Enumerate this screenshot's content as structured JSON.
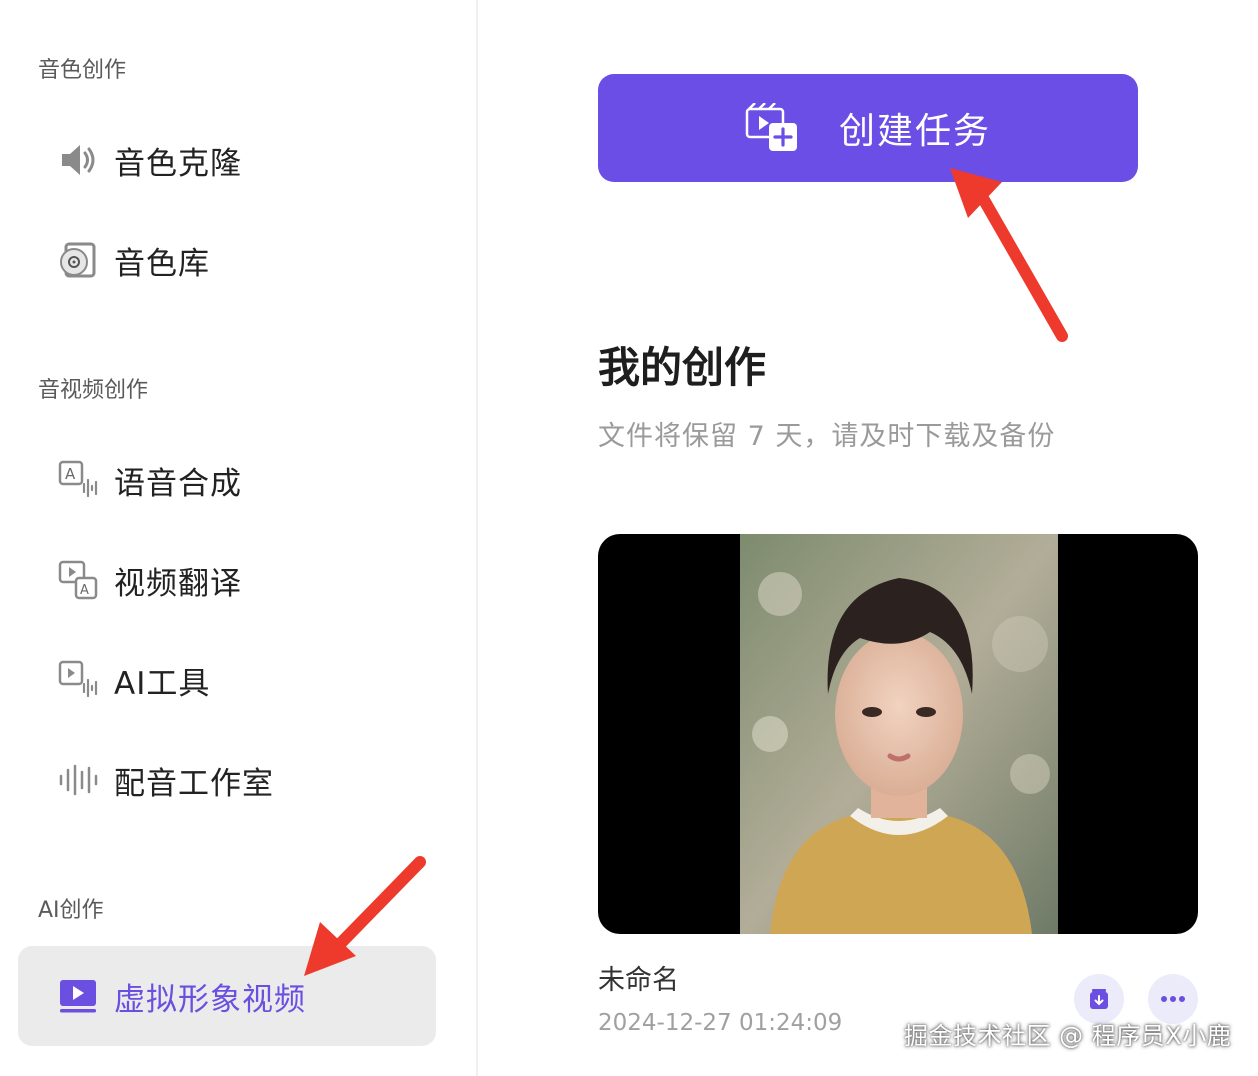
{
  "sidebar": {
    "sections": [
      {
        "title": "音色创作"
      },
      {
        "title": "音视频创作"
      },
      {
        "title": "AI创作"
      }
    ],
    "items": [
      {
        "label": "音色克隆",
        "icon": "speaker-icon"
      },
      {
        "label": "音色库",
        "icon": "disc-icon"
      },
      {
        "label": "语音合成",
        "icon": "text-to-speech-icon"
      },
      {
        "label": "视频翻译",
        "icon": "video-translate-icon"
      },
      {
        "label": "AI工具",
        "icon": "ai-tools-icon"
      },
      {
        "label": "配音工作室",
        "icon": "waveform-icon"
      },
      {
        "label": "虚拟形象视频",
        "icon": "play-video-icon",
        "active": true
      }
    ]
  },
  "main": {
    "create_button_label": "创建任务",
    "section_title": "我的创作",
    "section_subtitle": "文件将保留 7 天，请及时下载及备份",
    "card": {
      "name": "未命名",
      "date": "2024-12-27 01:24:09"
    }
  },
  "watermark": "掘金技术社区 @ 程序员X小鹿",
  "colors": {
    "accent": "#6a4ee6",
    "active_text": "#6a4fe0",
    "active_bg": "#ebebeb",
    "annotation_arrow": "#ee3a2c"
  }
}
